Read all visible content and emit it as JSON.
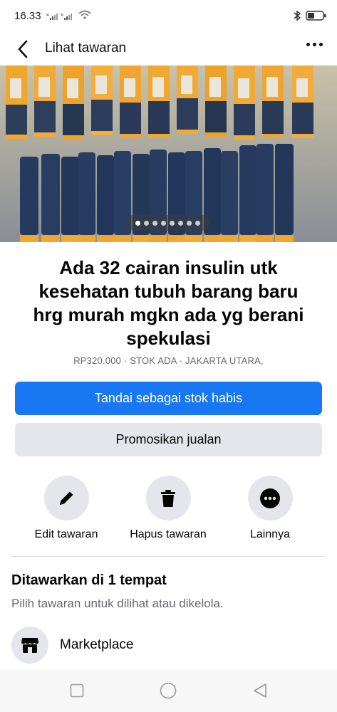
{
  "status_bar": {
    "time": "16.33"
  },
  "header": {
    "title": "Lihat tawaran"
  },
  "photo": {
    "page_count": 8,
    "active_index": 0
  },
  "listing": {
    "title": "Ada 32 cairan insulin utk kesehatan tubuh barang baru hrg murah mgkn ada yg berani spekulasi",
    "meta": "RP320.000 · STOK ADA · JAKARTA UTARA,"
  },
  "buttons": {
    "primary": "Tandai sebagai stok habis",
    "secondary": "Promosikan jualan"
  },
  "actions": [
    {
      "label": "Edit tawaran",
      "icon": "pencil-icon"
    },
    {
      "label": "Hapus tawaran",
      "icon": "trash-icon"
    },
    {
      "label": "Lainnya",
      "icon": "more-circle-icon"
    }
  ],
  "section": {
    "title": "Ditawarkan di 1 tempat",
    "subtitle": "Pilih tawaran untuk dilihat atau dikelola."
  },
  "marketplace": {
    "label": "Marketplace",
    "icon": "shop-icon"
  },
  "colors": {
    "accent": "#1877f2",
    "button_gray": "#e4e6eb",
    "muted_text": "#65676b"
  }
}
